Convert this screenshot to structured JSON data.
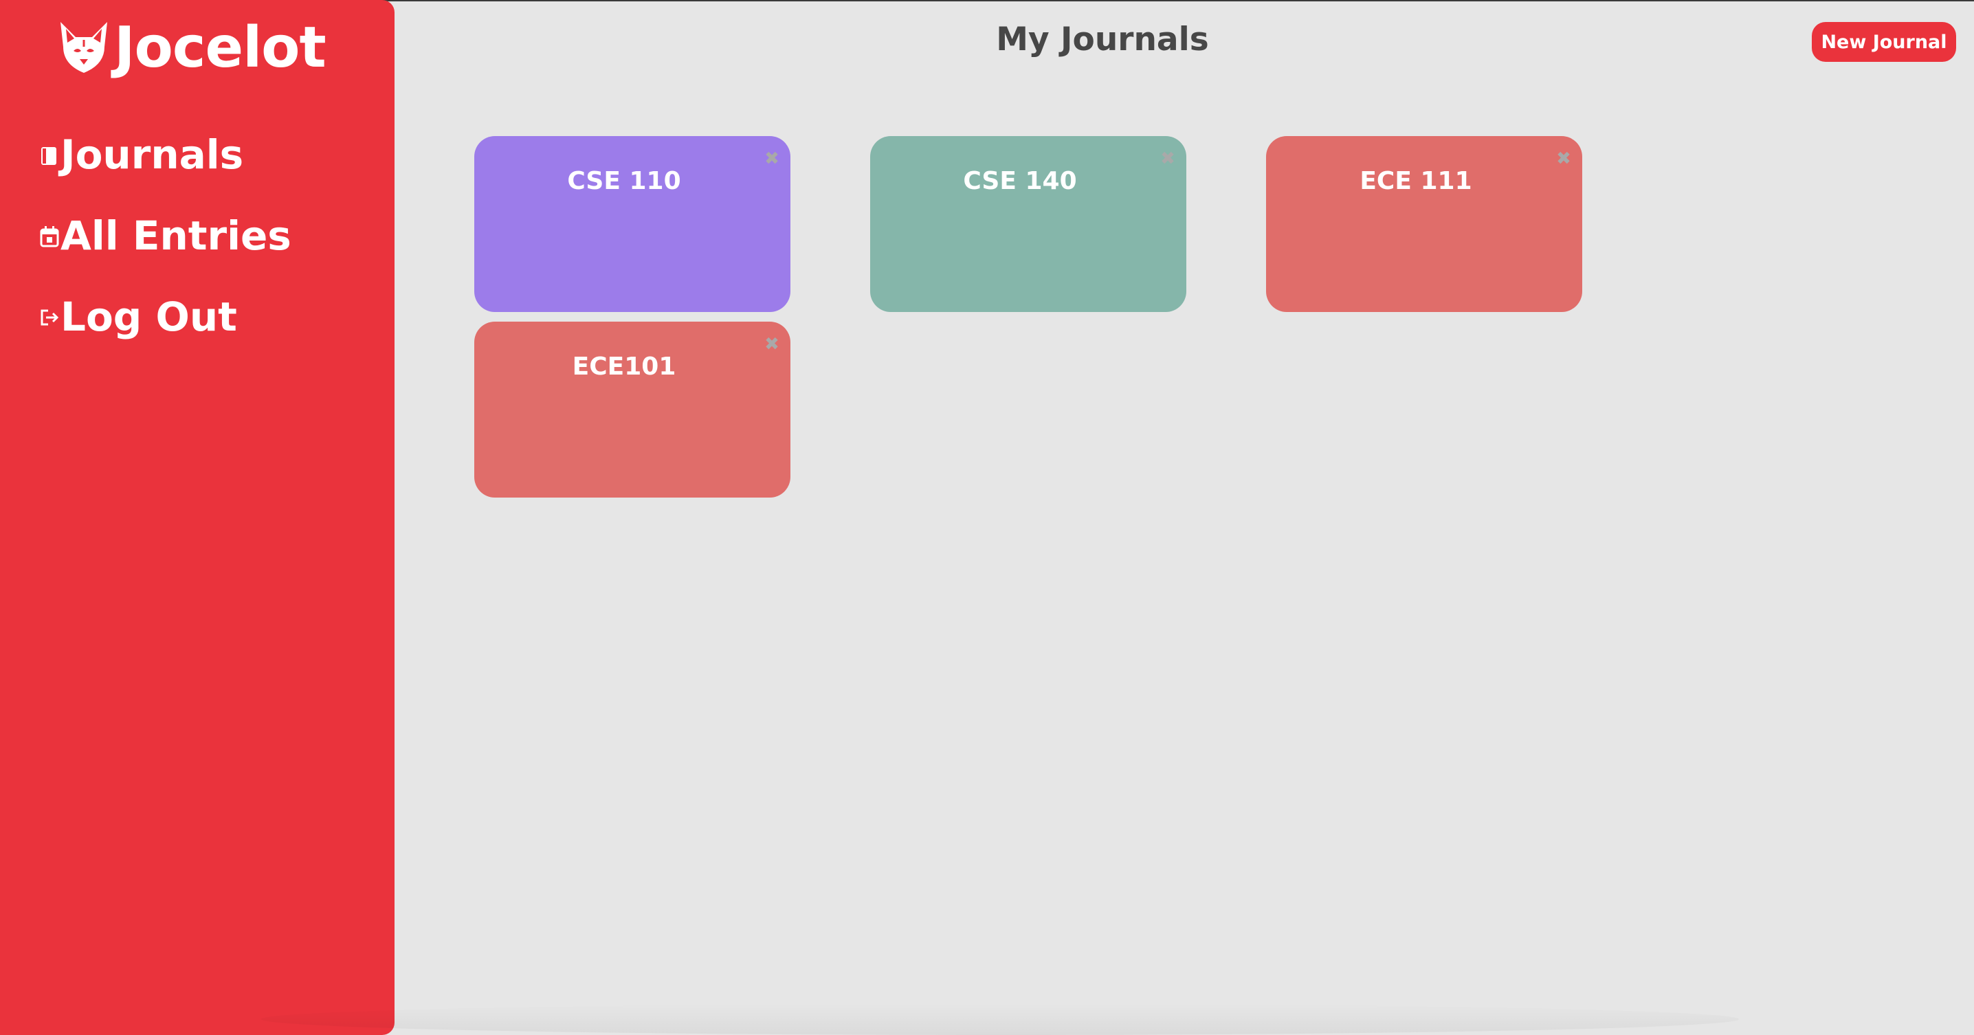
{
  "sidebar": {
    "logo_text": "Jocelot",
    "logo_icon": "ocelot-head-icon",
    "items": [
      {
        "label": "Journals",
        "icon": "journal-icon"
      },
      {
        "label": "All Entries",
        "icon": "calendar-icon"
      },
      {
        "label": "Log Out",
        "icon": "logout-icon"
      }
    ]
  },
  "header": {
    "title": "My Journals",
    "new_journal_label": "New Journal"
  },
  "journals": [
    {
      "title": "CSE 110",
      "color": "#9c7cea",
      "close_icon": "close-icon",
      "close_glyph": "✖"
    },
    {
      "title": "CSE 140",
      "color": "#85b6aa",
      "close_icon": "close-icon",
      "close_glyph": "✖"
    },
    {
      "title": "ECE 111",
      "color": "#e06d6a",
      "close_icon": "close-icon",
      "close_glyph": "✖"
    },
    {
      "title": "ECE101",
      "color": "#e06d6a",
      "close_icon": "close-icon",
      "close_glyph": "✖"
    }
  ],
  "colors": {
    "brand": "#ea333c",
    "background": "#e6e6e6",
    "title_text": "#474747"
  }
}
